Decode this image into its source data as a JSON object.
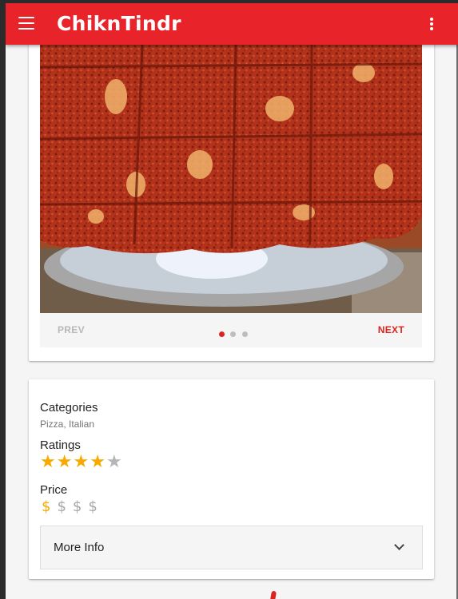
{
  "app": {
    "title": "ChiknTindr",
    "brand_color": "#e8232a",
    "menu_icon": "hamburger-menu-icon",
    "more_icon": "more-vert-icon"
  },
  "carousel": {
    "image_subject": "square-cut pizza slices",
    "prev_label": "PREV",
    "next_label": "NEXT",
    "slide_count": 3,
    "active_slide": 1
  },
  "info": {
    "categories_label": "Categories",
    "categories_value": "Pizza, Italian",
    "ratings_label": "Ratings",
    "rating": 4,
    "rating_max": 5,
    "price_label": "Price",
    "price_level": 1,
    "price_max": 4,
    "price_symbol": "$",
    "star_symbol": "★",
    "more_info_label": "More Info"
  },
  "colors": {
    "accent": "#d9251d",
    "star_on": "#f7a900",
    "star_off": "#b5b5b5"
  }
}
